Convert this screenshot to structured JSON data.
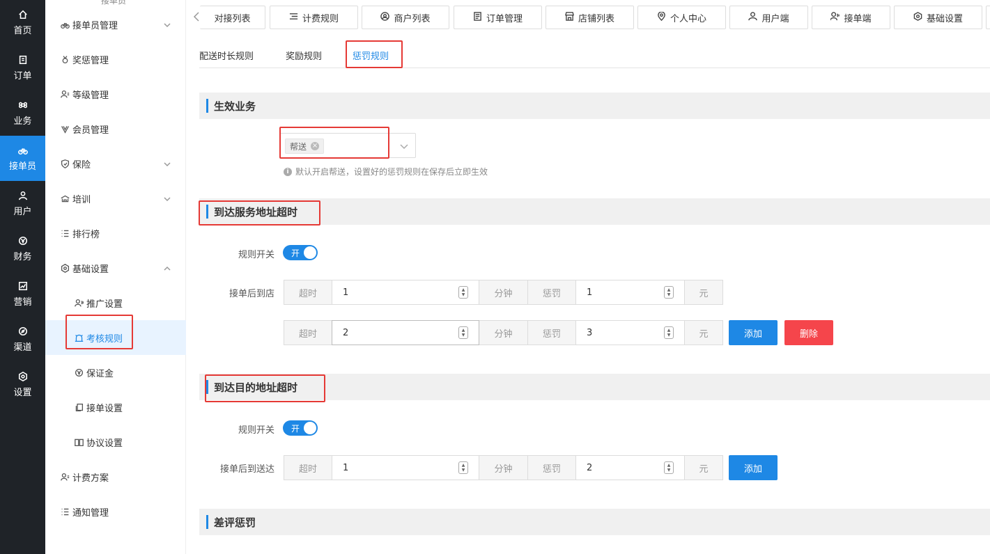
{
  "rail": {
    "items": [
      {
        "label": "首页",
        "icon": "home-icon"
      },
      {
        "label": "订单",
        "icon": "order-icon"
      },
      {
        "label": "业务",
        "icon": "command-icon"
      },
      {
        "label": "接单员",
        "icon": "bike-icon"
      },
      {
        "label": "用户",
        "icon": "user-icon"
      },
      {
        "label": "财务",
        "icon": "yen-icon"
      },
      {
        "label": "营销",
        "icon": "chart-icon"
      },
      {
        "label": "渠道",
        "icon": "compass-icon"
      },
      {
        "label": "设置",
        "icon": "settings-icon"
      }
    ]
  },
  "sidebar": {
    "cut_label": "接单员",
    "items": [
      {
        "label": "接单员管理",
        "icon": "bike-icon"
      },
      {
        "label": "奖惩管理",
        "icon": "medal-icon"
      },
      {
        "label": "等级管理",
        "icon": "user-level-icon"
      },
      {
        "label": "会员管理",
        "icon": "vip-icon"
      },
      {
        "label": "保险",
        "icon": "shield-icon"
      },
      {
        "label": "培训",
        "icon": "training-icon"
      },
      {
        "label": "排行榜",
        "icon": "list-icon"
      },
      {
        "label": "基础设置",
        "icon": "gear-icon"
      },
      {
        "label": "推广设置",
        "icon": "promote-icon"
      },
      {
        "label": "考核规则",
        "icon": "alarm-icon"
      },
      {
        "label": "保证金",
        "icon": "deposit-icon"
      },
      {
        "label": "接单设置",
        "icon": "copy-icon"
      },
      {
        "label": "协议设置",
        "icon": "book-icon"
      },
      {
        "label": "计费方案",
        "icon": "user-level-icon"
      },
      {
        "label": "通知管理",
        "icon": "list-icon"
      }
    ]
  },
  "topbar": {
    "tabs": [
      {
        "label": "对接列表",
        "icon": ""
      },
      {
        "label": "计费规则",
        "icon": "lines-icon"
      },
      {
        "label": "商户列表",
        "icon": "user-circle-icon"
      },
      {
        "label": "订单管理",
        "icon": "document-icon"
      },
      {
        "label": "店铺列表",
        "icon": "shop-icon"
      },
      {
        "label": "个人中心",
        "icon": "location-icon"
      },
      {
        "label": "用户端",
        "icon": "user-icon"
      },
      {
        "label": "接单端",
        "icon": "rider-icon"
      },
      {
        "label": "基础设置",
        "icon": "gear-icon"
      }
    ]
  },
  "subtabs": [
    "配送时长规则",
    "奖励规则",
    "惩罚规则"
  ],
  "sections": {
    "effective": {
      "title": "生效业务",
      "tag": "帮送",
      "hint": "默认开启帮送，设置好的惩罚规则在保存后立即生效"
    },
    "arrive_service": {
      "title": "到达服务地址超时",
      "switch_label": "规则开关",
      "switch_text": "开",
      "row_label": "接单后到店",
      "rows": [
        {
          "prefix": "超时",
          "value": "1",
          "unit": "分钟",
          "penalty_label": "惩罚",
          "penalty": "1",
          "currency": "元"
        },
        {
          "prefix": "超时",
          "value": "2",
          "unit": "分钟",
          "penalty_label": "惩罚",
          "penalty": "3",
          "currency": "元"
        }
      ],
      "add_label": "添加",
      "delete_label": "删除"
    },
    "arrive_dest": {
      "title": "到达目的地址超时",
      "switch_label": "规则开关",
      "switch_text": "开",
      "row_label": "接单后到送达",
      "rows": [
        {
          "prefix": "超时",
          "value": "1",
          "unit": "分钟",
          "penalty_label": "惩罚",
          "penalty": "2",
          "currency": "元"
        }
      ],
      "add_label": "添加"
    },
    "bad_review": {
      "title": "差评惩罚"
    }
  },
  "colors": {
    "accent": "#1e88e5",
    "danger": "#f5454b",
    "highlight": "#e53935",
    "rail_bg": "#1f2328"
  }
}
